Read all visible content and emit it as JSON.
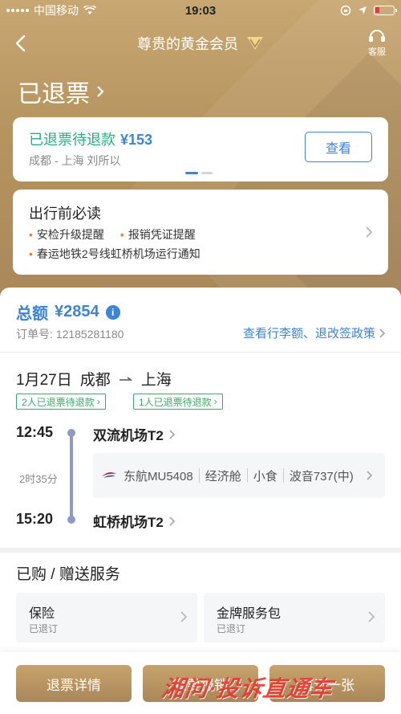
{
  "status_bar": {
    "carrier": "中国移动",
    "time": "19:03"
  },
  "nav": {
    "title": "尊贵的黄金会员",
    "service_label": "客服"
  },
  "status_title": "已退票",
  "refund_card": {
    "status": "已退票待退款",
    "amount": "¥153",
    "route_passenger": "成都 - 上海 刘所以",
    "view_label": "查看"
  },
  "notice": {
    "title": "出行前必读",
    "items_row1": [
      "安检升级提醒",
      "报销凭证提醒"
    ],
    "items_row2": [
      "春运地铁2号线虹桥机场运行通知"
    ]
  },
  "order": {
    "total_label": "总额",
    "total_amount": "¥2854",
    "order_no_label": "订单号:",
    "order_no": "12185281180",
    "policy_link": "查看行李额、退改签政策"
  },
  "flight": {
    "date": "1月27日",
    "from_city": "成都",
    "to_city": "上海",
    "tags": [
      "2人已退票待退款",
      "1人已退票待退款"
    ],
    "dep_time": "12:45",
    "dep_airport": "双流机场T2",
    "duration": "2时35分",
    "airline_flight": "东航MU5408",
    "cabin": "经济舱",
    "meal": "小食",
    "aircraft": "波音737(中)",
    "arr_time": "15:20",
    "arr_airport": "虹桥机场T2"
  },
  "services": {
    "title": "已购 / 赠送服务",
    "items": [
      {
        "name": "保险",
        "status": "已退订"
      },
      {
        "name": "金牌服务包",
        "status": "已退订"
      }
    ]
  },
  "bottom": {
    "buttons": [
      "退票详情",
      "我要报销",
      "再订一张"
    ]
  },
  "watermark": "湘问·投诉直通车",
  "colors": {
    "gold": "#b79560",
    "blue": "#3c84d6",
    "green": "#22b07d",
    "orange": "#ef7b2c"
  }
}
